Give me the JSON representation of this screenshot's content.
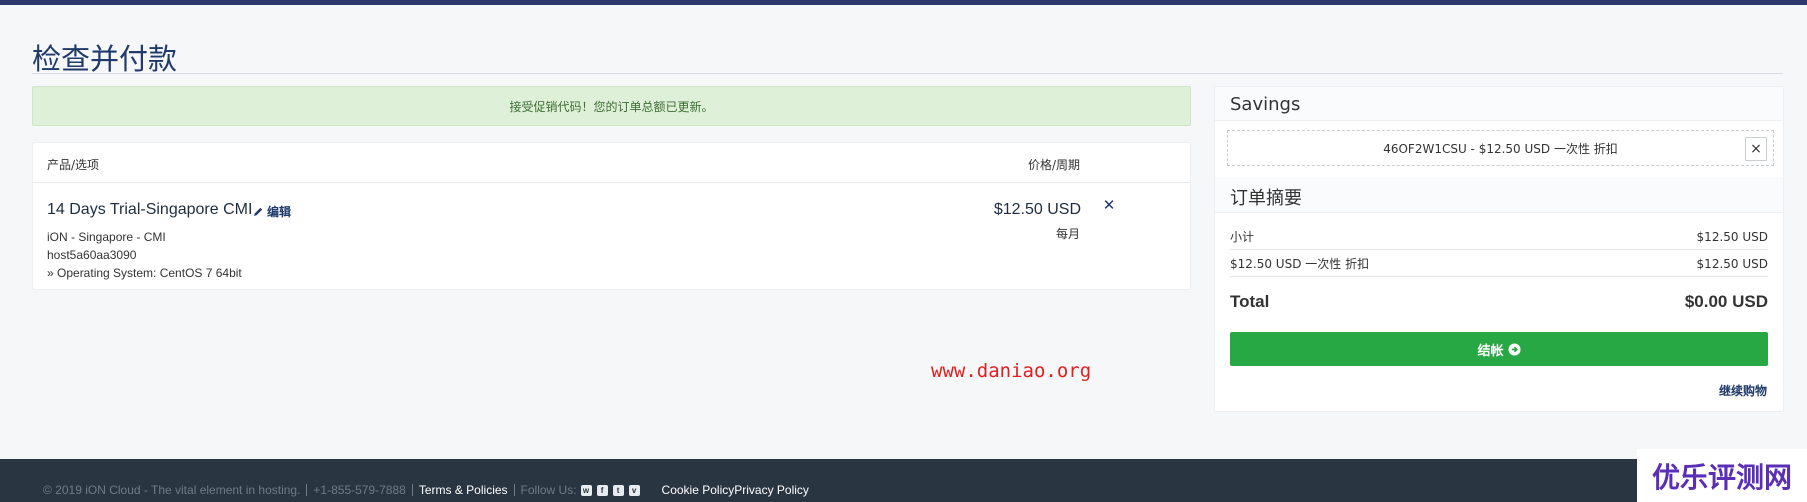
{
  "page": {
    "title": "检查并付款"
  },
  "alert": {
    "message": "接受促销代码！您的订单总额已更新。"
  },
  "cart": {
    "header_product": "产品/选项",
    "header_price": "价格/周期",
    "item": {
      "name": "14 Days Trial-Singapore CMI",
      "edit_label": "编辑",
      "group": "iON - Singapore - CMI",
      "hostname": "host5a60aa3090",
      "option": "» Operating System: CentOS 7 64bit",
      "price": "$12.50 USD",
      "cycle": "每月"
    }
  },
  "watermark": {
    "site": "www.daniao.org",
    "brand": "优乐评测网"
  },
  "sidebar": {
    "savings_title": "Savings",
    "promo_text": "46OF2W1CSU - $12.50 USD 一次性 折扣",
    "summary_title": "订单摘要",
    "rows": [
      {
        "label": "小计",
        "value": "$12.50 USD"
      },
      {
        "label": "$12.50 USD 一次性 折扣",
        "value": "$12.50 USD"
      }
    ],
    "total_label": "Total",
    "total_value": "$0.00 USD",
    "checkout_label": "结帐",
    "continue_label": "继续购物"
  },
  "footer": {
    "copyright": "© 2019 iON Cloud - The vital element in hosting.",
    "phone": "+1-855-579-7888",
    "terms": "Terms & Policies",
    "follow": "Follow Us:",
    "cookie": "Cookie Policy",
    "privacy": "Privacy Policy"
  },
  "colors": {
    "accent": "#1f3a6b",
    "checkout": "#28a745",
    "alert_bg": "#dff0d8",
    "footer_bg": "#2a3542"
  }
}
